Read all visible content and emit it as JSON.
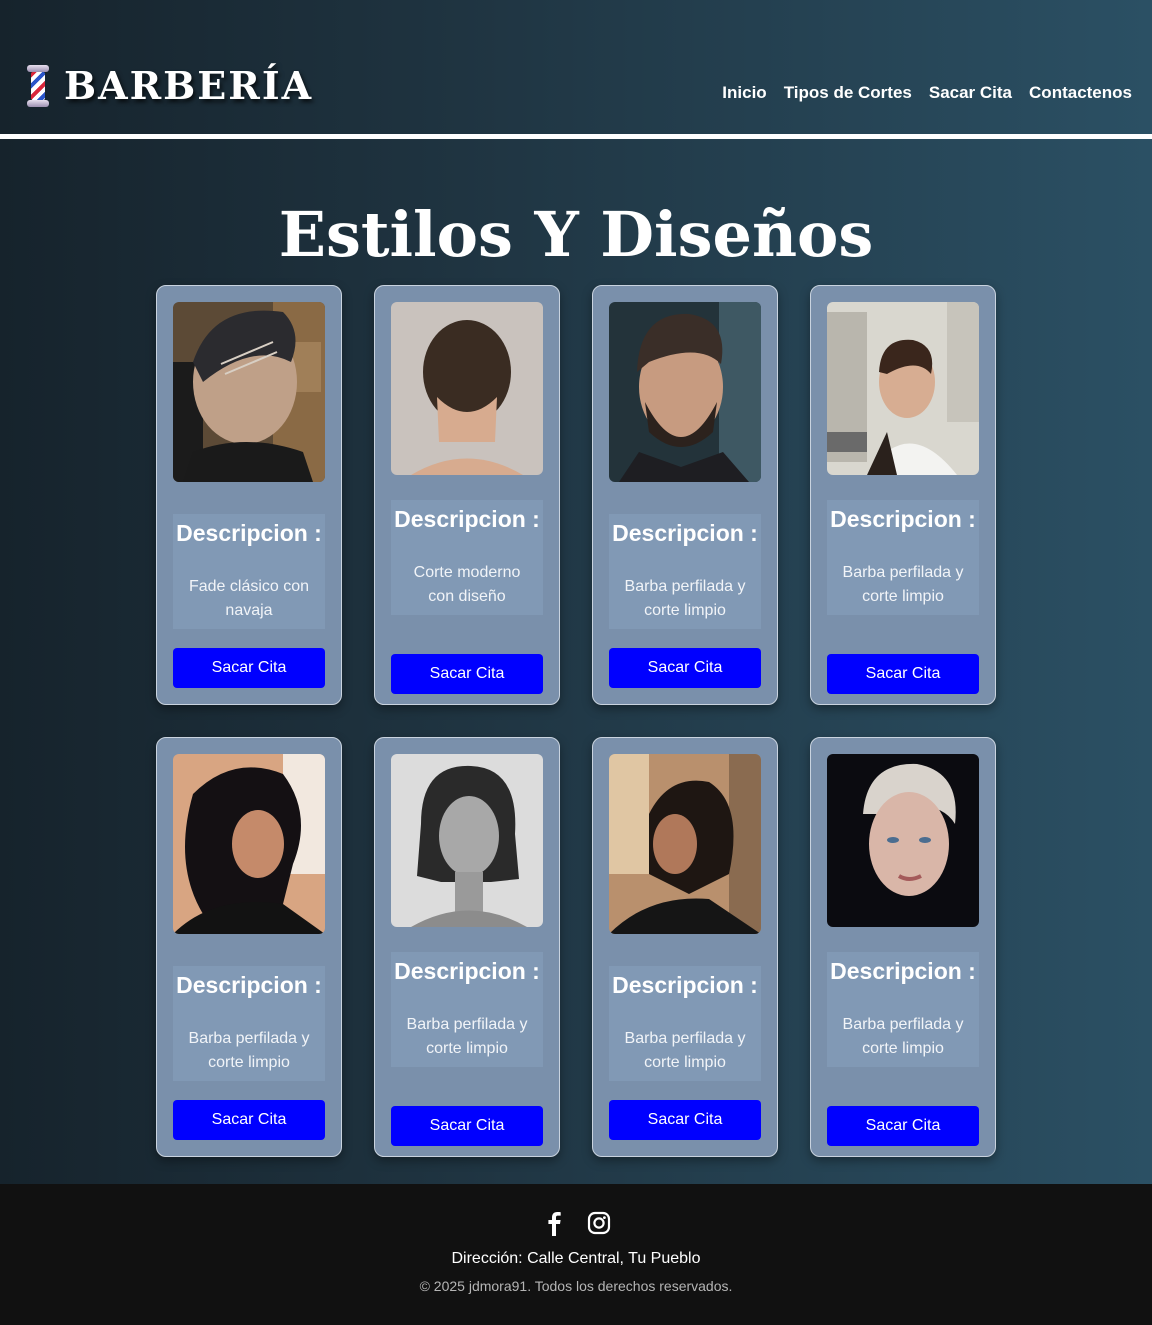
{
  "header": {
    "brand": "BARBERÍA",
    "nav": [
      "Inicio",
      "Tipos de Cortes",
      "Sacar Cita",
      "Contactenos"
    ]
  },
  "main": {
    "title": "Estilos Y Diseños",
    "cards": [
      {
        "heading": "Descripcion :",
        "text": "Fade clásico con navaja",
        "button": "Sacar Cita",
        "photo": "man-fade-haircut-photo"
      },
      {
        "heading": "Descripcion :",
        "text": "Corte moderno con diseño",
        "button": "Sacar Cita",
        "photo": "man-back-haircut-photo"
      },
      {
        "heading": "Descripcion :",
        "text": "Barba perfilada y corte limpio",
        "button": "Sacar Cita",
        "photo": "man-beard-photo"
      },
      {
        "heading": "Descripcion :",
        "text": "Barba perfilada y corte limpio",
        "button": "Sacar Cita",
        "photo": "man-street-photo"
      },
      {
        "heading": "Descripcion :",
        "text": "Barba perfilada y corte limpio",
        "button": "Sacar Cita",
        "photo": "woman-curly-hair-photo"
      },
      {
        "heading": "Descripcion :",
        "text": "Barba perfilada y corte limpio",
        "button": "Sacar Cita",
        "photo": "woman-bob-photo"
      },
      {
        "heading": "Descripcion :",
        "text": "Barba perfilada y corte limpio",
        "button": "Sacar Cita",
        "photo": "woman-salon-photo"
      },
      {
        "heading": "Descripcion :",
        "text": "Barba perfilada y corte limpio",
        "button": "Sacar Cita",
        "photo": "woman-pixie-photo"
      }
    ]
  },
  "footer": {
    "address": "Dirección: Calle Central, Tu Pueblo",
    "copyright": "© 2025 jdmora91. Todos los derechos reservados.",
    "icons": [
      "facebook-icon",
      "instagram-icon"
    ]
  },
  "colors": {
    "card_bg": "#7a90ab",
    "button": "#0000ff",
    "footer_bg": "#111111"
  }
}
